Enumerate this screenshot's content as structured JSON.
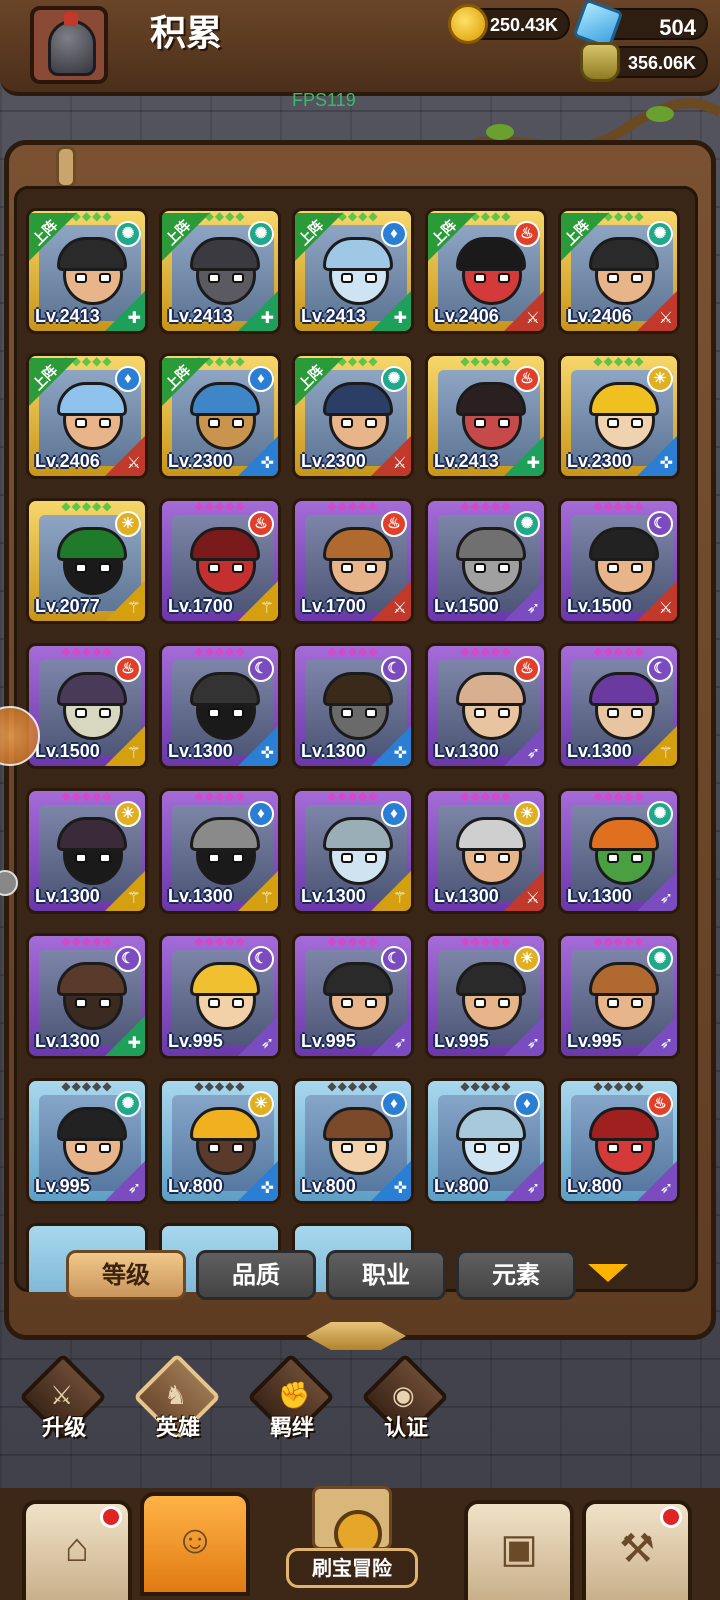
{
  "player": {
    "name": "积累"
  },
  "resources": {
    "gold": "250.43K",
    "gems": "504",
    "potion": "356.06K"
  },
  "fps": "FPS119",
  "deploy_badge": "上阵",
  "heroes": [
    {
      "level": "Lv.2413",
      "rarity": "gold",
      "deployed": true,
      "element": "wind",
      "role": "tank",
      "skin": "#e8b48a",
      "hair": "#2a2a2a"
    },
    {
      "level": "Lv.2413",
      "rarity": "gold",
      "deployed": true,
      "element": "wind",
      "role": "tank",
      "skin": "#5a5a60",
      "hair": "#3a3a40"
    },
    {
      "level": "Lv.2413",
      "rarity": "gold",
      "deployed": true,
      "element": "water",
      "role": "tank",
      "skin": "#cfe4f2",
      "hair": "#9fc8e6"
    },
    {
      "level": "Lv.2406",
      "rarity": "gold",
      "deployed": true,
      "element": "fire",
      "role": "warrior",
      "skin": "#d43a3a",
      "hair": "#1a1a1a"
    },
    {
      "level": "Lv.2406",
      "rarity": "gold",
      "deployed": true,
      "element": "wind",
      "role": "warrior",
      "skin": "#e8b48a",
      "hair": "#2a2a2a"
    },
    {
      "level": "Lv.2406",
      "rarity": "gold",
      "deployed": true,
      "element": "water",
      "role": "warrior",
      "skin": "#e8b48a",
      "hair": "#8fc2ec"
    },
    {
      "level": "Lv.2300",
      "rarity": "gold",
      "deployed": true,
      "element": "water",
      "role": "priest",
      "skin": "#c9954e",
      "hair": "#3f86c8"
    },
    {
      "level": "Lv.2300",
      "rarity": "gold",
      "deployed": true,
      "element": "wind",
      "role": "warrior",
      "skin": "#e8b48a",
      "hair": "#2b3f66"
    },
    {
      "level": "Lv.2413",
      "rarity": "gold",
      "deployed": false,
      "element": "fire",
      "role": "tank",
      "skin": "#c74a4a",
      "hair": "#2b2020"
    },
    {
      "level": "Lv.2300",
      "rarity": "gold",
      "deployed": false,
      "element": "light",
      "role": "priest",
      "skin": "#efd2b0",
      "hair": "#f0c020"
    },
    {
      "level": "Lv.2077",
      "rarity": "gold",
      "deployed": false,
      "element": "light",
      "role": "mage",
      "skin": "#1a1a1a",
      "hair": "#1f7a2a"
    },
    {
      "level": "Lv.1700",
      "rarity": "purple",
      "deployed": false,
      "element": "fire",
      "role": "mage",
      "skin": "#c43030",
      "hair": "#7a1a1a"
    },
    {
      "level": "Lv.1700",
      "rarity": "purple",
      "deployed": false,
      "element": "fire",
      "role": "warrior",
      "skin": "#e8b48a",
      "hair": "#b06a30"
    },
    {
      "level": "Lv.1500",
      "rarity": "purple",
      "deployed": false,
      "element": "wind",
      "role": "archer",
      "skin": "#a0a0a0",
      "hair": "#707070"
    },
    {
      "level": "Lv.1500",
      "rarity": "purple",
      "deployed": false,
      "element": "dark",
      "role": "warrior",
      "skin": "#e8b48a",
      "hair": "#222"
    },
    {
      "level": "Lv.1500",
      "rarity": "purple",
      "deployed": false,
      "element": "fire",
      "role": "mage",
      "skin": "#d8d8c0",
      "hair": "#4a3a5a"
    },
    {
      "level": "Lv.1300",
      "rarity": "purple",
      "deployed": false,
      "element": "dark",
      "role": "priest",
      "skin": "#1a1a1a",
      "hair": "#333"
    },
    {
      "level": "Lv.1300",
      "rarity": "purple",
      "deployed": false,
      "element": "dark",
      "role": "priest",
      "skin": "#6a6a6a",
      "hair": "#3a2a1a"
    },
    {
      "level": "Lv.1300",
      "rarity": "purple",
      "deployed": false,
      "element": "fire",
      "role": "archer",
      "skin": "#e8c4a0",
      "hair": "#d8b090"
    },
    {
      "level": "Lv.1300",
      "rarity": "purple",
      "deployed": false,
      "element": "dark",
      "role": "mage",
      "skin": "#e8c4a0",
      "hair": "#6a3aa0"
    },
    {
      "level": "Lv.1300",
      "rarity": "purple",
      "deployed": false,
      "element": "light",
      "role": "mage",
      "skin": "#1a1a1a",
      "hair": "#3a2a3a"
    },
    {
      "level": "Lv.1300",
      "rarity": "purple",
      "deployed": false,
      "element": "water",
      "role": "mage",
      "skin": "#1a1a1a",
      "hair": "#8a8a8a"
    },
    {
      "level": "Lv.1300",
      "rarity": "purple",
      "deployed": false,
      "element": "water",
      "role": "mage",
      "skin": "#cfe4f0",
      "hair": "#9aaeb8"
    },
    {
      "level": "Lv.1300",
      "rarity": "purple",
      "deployed": false,
      "element": "light",
      "role": "warrior",
      "skin": "#e8b48a",
      "hair": "#cfcfcf"
    },
    {
      "level": "Lv.1300",
      "rarity": "purple",
      "deployed": false,
      "element": "wind",
      "role": "archer",
      "skin": "#4aa040",
      "hair": "#e07020"
    },
    {
      "level": "Lv.1300",
      "rarity": "purple",
      "deployed": false,
      "element": "dark",
      "role": "tank",
      "skin": "#3a2a20",
      "hair": "#5a3a2a"
    },
    {
      "level": "Lv.995",
      "rarity": "purple",
      "deployed": false,
      "element": "dark",
      "role": "archer",
      "skin": "#f2d0a8",
      "hair": "#f0c030"
    },
    {
      "level": "Lv.995",
      "rarity": "purple",
      "deployed": false,
      "element": "dark",
      "role": "archer",
      "skin": "#e8b48a",
      "hair": "#2a2a2a"
    },
    {
      "level": "Lv.995",
      "rarity": "purple",
      "deployed": false,
      "element": "light",
      "role": "archer",
      "skin": "#e8b48a",
      "hair": "#2a2a2a"
    },
    {
      "level": "Lv.995",
      "rarity": "purple",
      "deployed": false,
      "element": "wind",
      "role": "archer",
      "skin": "#e8b48a",
      "hair": "#b06a30"
    },
    {
      "level": "Lv.995",
      "rarity": "blue",
      "deployed": false,
      "element": "wind",
      "role": "archer",
      "skin": "#e8b48a",
      "hair": "#222"
    },
    {
      "level": "Lv.800",
      "rarity": "blue",
      "deployed": false,
      "element": "light",
      "role": "priest",
      "skin": "#5a3a2a",
      "hair": "#f0b020"
    },
    {
      "level": "Lv.800",
      "rarity": "blue",
      "deployed": false,
      "element": "water",
      "role": "priest",
      "skin": "#f2d0a8",
      "hair": "#7a4a2a"
    },
    {
      "level": "Lv.800",
      "rarity": "blue",
      "deployed": false,
      "element": "water",
      "role": "archer",
      "skin": "#cfe4f2",
      "hair": "#a8c8dc"
    },
    {
      "level": "Lv.800",
      "rarity": "blue",
      "deployed": false,
      "element": "fire",
      "role": "archer",
      "skin": "#d43a3a",
      "hair": "#a02020"
    }
  ],
  "elements": {
    "wind": {
      "color": "#1fa88a",
      "glyph": "✺"
    },
    "water": {
      "color": "#2a7fd4",
      "glyph": "♦"
    },
    "fire": {
      "color": "#e0402a",
      "glyph": "♨"
    },
    "light": {
      "color": "#e0b020",
      "glyph": "☀"
    },
    "dark": {
      "color": "#7b4cc0",
      "glyph": "☾"
    }
  },
  "roles": {
    "tank": {
      "color": "#1fa05a",
      "glyph": "✚"
    },
    "warrior": {
      "color": "#c0392b",
      "glyph": "⚔"
    },
    "priest": {
      "color": "#2a7fd4",
      "glyph": "✜"
    },
    "mage": {
      "color": "#d4a010",
      "glyph": "⚚"
    },
    "archer": {
      "color": "#7a4cc0",
      "glyph": "➶"
    }
  },
  "sort_tabs": [
    "等级",
    "品质",
    "职业",
    "元素"
  ],
  "subnav": [
    {
      "label": "升级",
      "icon": "sword-icon"
    },
    {
      "label": "英雄",
      "icon": "hero-icon"
    },
    {
      "label": "羁绊",
      "icon": "handshake-icon"
    },
    {
      "label": "认证",
      "icon": "eye-icon"
    }
  ],
  "bottom_nav": {
    "shop_icon": "shop-icon",
    "heroes_icon": "hero-portrait-icon",
    "adventure_label": "刷宝冒险",
    "inventory_icon": "backpack-icon",
    "forge_icon": "hammer-icon"
  }
}
